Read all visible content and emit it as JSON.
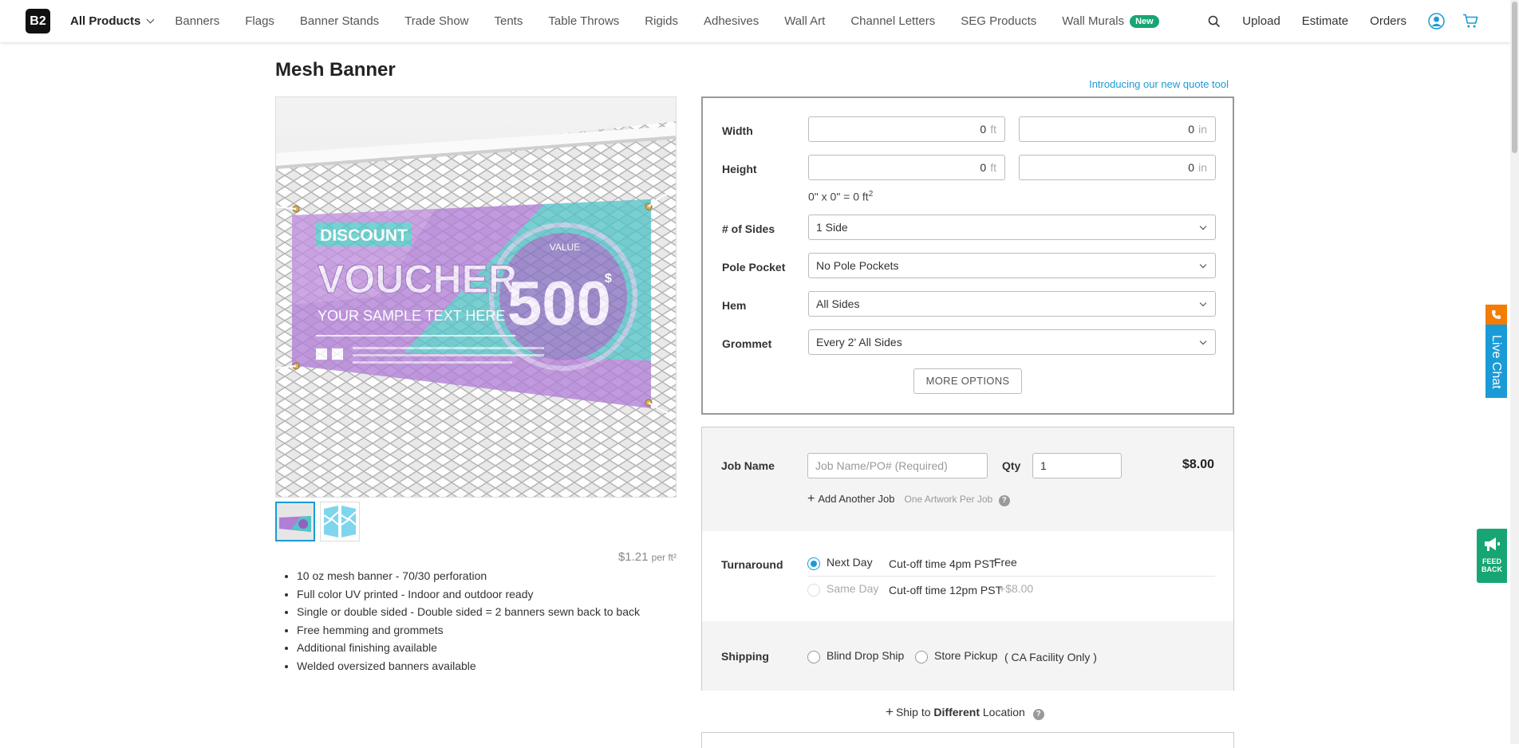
{
  "nav": {
    "logo": "B2",
    "items": [
      "All Products",
      "Banners",
      "Flags",
      "Banner Stands",
      "Trade Show",
      "Tents",
      "Table Throws",
      "Rigids",
      "Adhesives",
      "Wall Art",
      "Channel Letters",
      "SEG Products",
      "Wall Murals"
    ],
    "new_badge": "New",
    "upload": "Upload",
    "estimate": "Estimate",
    "orders": "Orders"
  },
  "product": {
    "title": "Mesh Banner",
    "promo_link": "Introducing our new quote tool",
    "price_unit": "$1.21",
    "price_unit_suffix": "per ft²",
    "features": [
      "10 oz mesh banner - 70/30 perforation",
      "Full color UV printed - Indoor and outdoor ready",
      "Single or double sided - Double sided = 2 banners sewn back to back",
      "Free hemming and grommets",
      "Additional finishing available",
      "Welded oversized banners available"
    ],
    "banner_art": {
      "discount": "DISCOUNT",
      "voucher": "VOUCHER",
      "sample": "YOUR SAMPLE TEXT HERE",
      "value_label": "VALUE",
      "value": "500",
      "currency": "$"
    }
  },
  "options": {
    "width_label": "Width",
    "height_label": "Height",
    "width_ft": "0",
    "width_in": "0",
    "height_ft": "0",
    "height_in": "0",
    "unit_ft": "ft",
    "unit_in": "in",
    "area_text": "0\" x 0\" = 0 ft",
    "area_sup": "2",
    "sides_label": "# of Sides",
    "sides_value": "1 Side",
    "pole_label": "Pole Pocket",
    "pole_value": "No Pole Pockets",
    "hem_label": "Hem",
    "hem_value": "All Sides",
    "grommet_label": "Grommet",
    "grommet_value": "Every 2' All Sides",
    "more_options": "MORE OPTIONS"
  },
  "order": {
    "job_label": "Job Name",
    "job_placeholder": "Job Name/PO# (Required)",
    "qty_label": "Qty",
    "qty_value": "1",
    "total": "$8.00",
    "add_job": "Add Another Job",
    "one_artwork": "One Artwork Per Job",
    "turnaround_label": "Turnaround",
    "next_day": "Next Day",
    "next_day_cutoff": "Cut-off time 4pm PST",
    "next_day_price": "Free",
    "same_day": "Same Day",
    "same_day_cutoff": "Cut-off time 12pm PST",
    "same_day_price": "+$8.00",
    "shipping_label": "Shipping",
    "blind_drop": "Blind Drop Ship",
    "store_pickup": "Store Pickup",
    "ca_only": "( CA Facility Only )",
    "ship_diff_prefix": "Ship to",
    "ship_diff_bold": "Different",
    "ship_diff_suffix": "Location"
  },
  "widgets": {
    "live_chat": "Live Chat",
    "feedback_line1": "FEED",
    "feedback_line2": "BACK"
  },
  "colors": {
    "accent": "#1a9bd7",
    "new_badge": "#17a673",
    "live_chat_phone": "#f57c00"
  }
}
